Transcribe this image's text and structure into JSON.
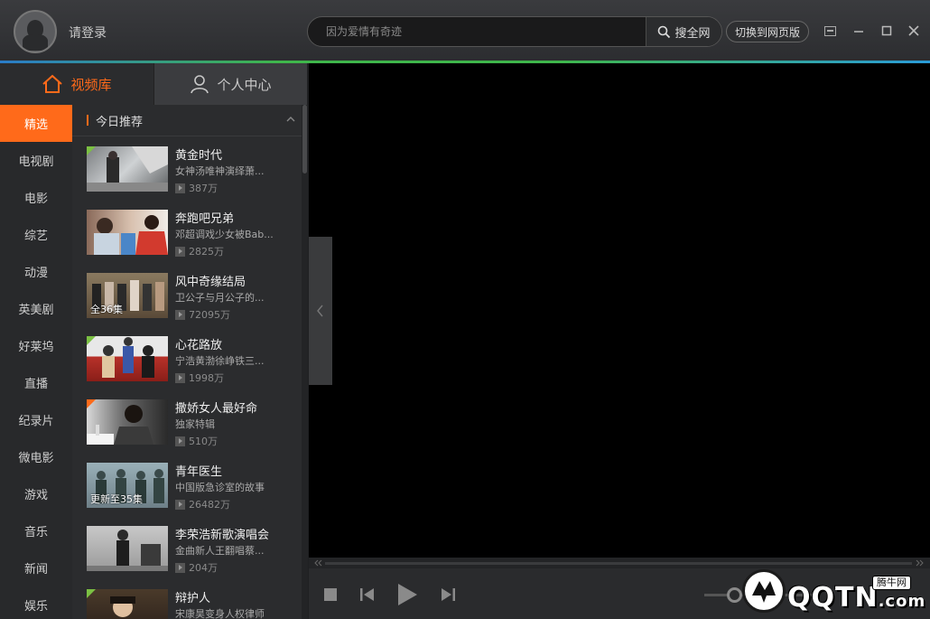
{
  "header": {
    "login_text": "请登录",
    "search_placeholder": "因为爱情有奇迹",
    "search_button": "搜全网",
    "switch_button": "切换到网页版"
  },
  "tabs": [
    {
      "label": "视频库",
      "icon": "home-icon",
      "active": true
    },
    {
      "label": "个人中心",
      "icon": "user-icon",
      "active": false
    }
  ],
  "categories": [
    "精选",
    "电视剧",
    "电影",
    "综艺",
    "动漫",
    "英美剧",
    "好莱坞",
    "直播",
    "纪录片",
    "微电影",
    "游戏",
    "音乐",
    "新闻",
    "娱乐"
  ],
  "list": {
    "section_title": "今日推荐",
    "items": [
      {
        "title": "黄金时代",
        "desc": "女神汤唯神演绎萧...",
        "views": "387万",
        "episode": "",
        "corner": "green"
      },
      {
        "title": "奔跑吧兄弟",
        "desc": "邓超调戏少女被Bab...",
        "views": "2825万",
        "episode": "",
        "corner": ""
      },
      {
        "title": "风中奇缘结局",
        "desc": "卫公子与月公子的...",
        "views": "72095万",
        "episode": "全36集",
        "corner": ""
      },
      {
        "title": "心花路放",
        "desc": "宁浩黄渤徐峥铁三...",
        "views": "1998万",
        "episode": "",
        "corner": "green"
      },
      {
        "title": "撒娇女人最好命",
        "desc": "独家特辑",
        "views": "510万",
        "episode": "",
        "corner": "orange"
      },
      {
        "title": "青年医生",
        "desc": "中国版急诊室的故事",
        "views": "26482万",
        "episode": "更新至35集",
        "corner": ""
      },
      {
        "title": "李荣浩新歌演唱会",
        "desc": "金曲新人王翻唱蔡...",
        "views": "204万",
        "episode": "",
        "corner": ""
      },
      {
        "title": "辩护人",
        "desc": "宋康昊变身人权律师",
        "views": "",
        "episode": "",
        "corner": "green"
      }
    ]
  },
  "watermark": {
    "text": "QQTN",
    "suffix": ".com",
    "badge": "腾牛网"
  },
  "colors": {
    "accent": "#ff6a1a",
    "corner_green": "#7bc043"
  }
}
